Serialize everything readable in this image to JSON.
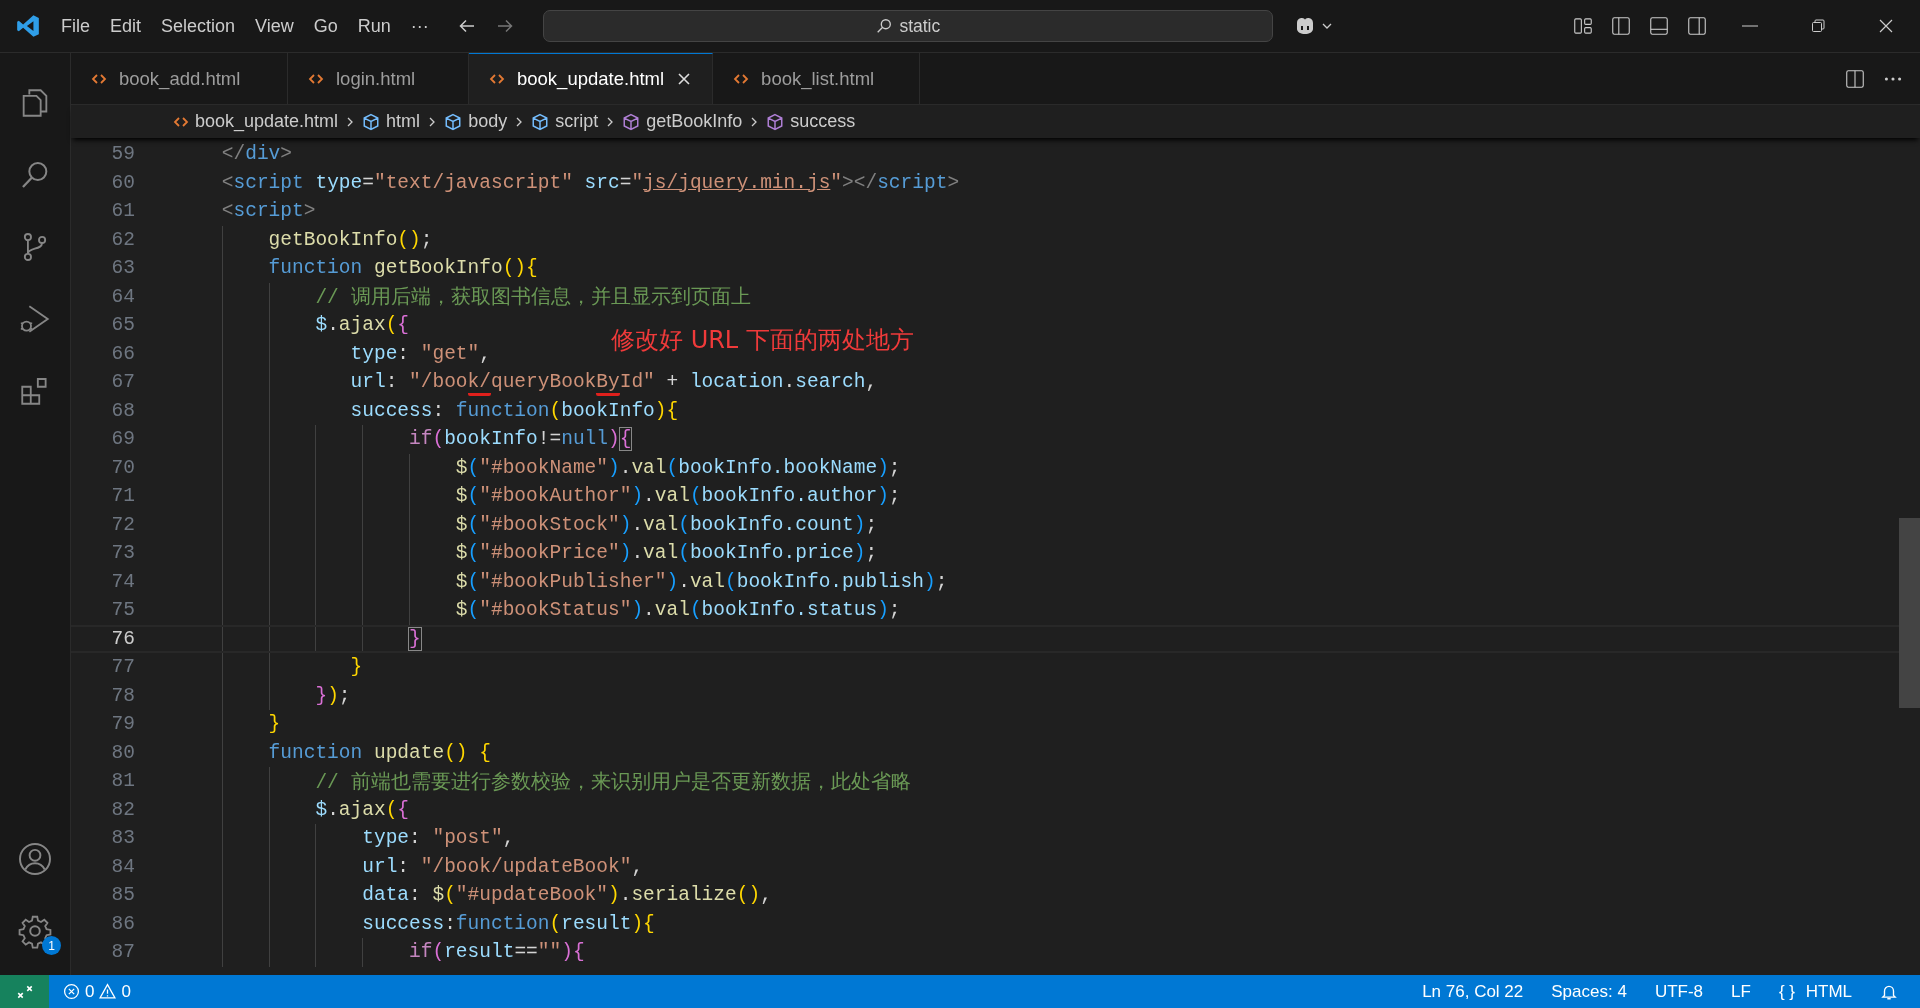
{
  "title_bar": {
    "menu": [
      "File",
      "Edit",
      "Selection",
      "View",
      "Go",
      "Run",
      "···"
    ],
    "search": {
      "value": "static"
    }
  },
  "activity_bar": {
    "items": [
      {
        "kind": "explorer",
        "selected": false
      },
      {
        "kind": "search",
        "selected": false
      },
      {
        "kind": "source-control",
        "selected": false
      },
      {
        "kind": "run-debug",
        "selected": false
      },
      {
        "kind": "extensions",
        "selected": false
      }
    ],
    "settings_badge": "1"
  },
  "tabs": [
    {
      "label": "book_add.html",
      "selected": false
    },
    {
      "label": "login.html",
      "selected": false
    },
    {
      "label": "book_update.html",
      "selected": true
    },
    {
      "label": "book_list.html",
      "selected": false
    }
  ],
  "breadcrumb": [
    {
      "kind": "file",
      "label": "book_update.html"
    },
    {
      "kind": "element",
      "label": "html"
    },
    {
      "kind": "element",
      "label": "body"
    },
    {
      "kind": "element",
      "label": "script"
    },
    {
      "kind": "method",
      "label": "getBookInfo"
    },
    {
      "kind": "method",
      "label": "success"
    }
  ],
  "annotation": "修改好 URL 下面的两处地方",
  "lines": [
    {
      "number": "59",
      "current": false,
      "tokens": [
        {
          "kind": "punc",
          "text": "    </"
        },
        {
          "kind": "tag",
          "text": "div"
        },
        {
          "kind": "punc",
          "text": ">"
        }
      ]
    },
    {
      "number": "60",
      "current": false,
      "tokens": [
        {
          "kind": "punc",
          "text": "    <"
        },
        {
          "kind": "tag",
          "text": "script "
        },
        {
          "kind": "attr",
          "text": "type"
        },
        {
          "kind": "txt",
          "text": "="
        },
        {
          "kind": "str",
          "text": "\"text/javascript\" "
        },
        {
          "kind": "attr",
          "text": "src"
        },
        {
          "kind": "txt",
          "text": "="
        },
        {
          "kind": "str",
          "text": "\""
        },
        {
          "kind": "link",
          "text": "js/jquery.min.js"
        },
        {
          "kind": "str",
          "text": "\""
        },
        {
          "kind": "punc",
          "text": "></"
        },
        {
          "kind": "tag",
          "text": "script"
        },
        {
          "kind": "punc",
          "text": ">"
        }
      ]
    },
    {
      "number": "61",
      "current": false,
      "tokens": [
        {
          "kind": "punc",
          "text": "    <"
        },
        {
          "kind": "tag",
          "text": "script"
        },
        {
          "kind": "punc",
          "text": ">"
        }
      ]
    },
    {
      "number": "62",
      "current": false,
      "tokens": [
        {
          "kind": "fn",
          "text": "        getBookInfo"
        },
        {
          "kind": "b1",
          "text": "()"
        },
        {
          "kind": "txt",
          "text": ";"
        }
      ]
    },
    {
      "number": "63",
      "current": false,
      "tokens": [
        {
          "kind": "kw",
          "text": "        function "
        },
        {
          "kind": "fn",
          "text": "getBookInfo"
        },
        {
          "kind": "b1",
          "text": "(){"
        }
      ]
    },
    {
      "number": "64",
      "current": false,
      "tokens": [
        {
          "kind": "cmt",
          "text": "            // 调用后端，获取图书信息，并且显示到页面上"
        }
      ]
    },
    {
      "number": "65",
      "current": false,
      "tokens": [
        {
          "kind": "var",
          "text": "            $"
        },
        {
          "kind": "txt",
          "text": "."
        },
        {
          "kind": "fn",
          "text": "ajax"
        },
        {
          "kind": "b1",
          "text": "("
        },
        {
          "kind": "b2",
          "text": "{"
        }
      ]
    },
    {
      "number": "66",
      "current": false,
      "tokens": [
        {
          "kind": "var",
          "text": "               type"
        },
        {
          "kind": "txt",
          "text": ": "
        },
        {
          "kind": "str",
          "text": "\"get\""
        },
        {
          "kind": "txt",
          "text": ","
        }
      ]
    },
    {
      "number": "67",
      "current": false,
      "tokens": [
        {
          "kind": "var",
          "text": "               url"
        },
        {
          "kind": "txt",
          "text": ": "
        },
        {
          "kind": "str",
          "text": "\"/boo"
        },
        {
          "kind": "str",
          "text": "k/",
          "underline": true
        },
        {
          "kind": "str",
          "text": "queryBook"
        },
        {
          "kind": "str",
          "text": "By",
          "underline": true
        },
        {
          "kind": "str",
          "text": "Id\""
        },
        {
          "kind": "txt",
          "text": " + "
        },
        {
          "kind": "var",
          "text": "location"
        },
        {
          "kind": "txt",
          "text": "."
        },
        {
          "kind": "var",
          "text": "search"
        },
        {
          "kind": "txt",
          "text": ","
        }
      ]
    },
    {
      "number": "68",
      "current": false,
      "tokens": [
        {
          "kind": "var",
          "text": "               success"
        },
        {
          "kind": "txt",
          "text": ": "
        },
        {
          "kind": "kw",
          "text": "function"
        },
        {
          "kind": "b1",
          "text": "("
        },
        {
          "kind": "var",
          "text": "bookInfo"
        },
        {
          "kind": "b1",
          "text": "){"
        }
      ]
    },
    {
      "number": "69",
      "current": false,
      "tokens": [
        {
          "kind": "ctl",
          "text": "                    if"
        },
        {
          "kind": "b2",
          "text": "("
        },
        {
          "kind": "var",
          "text": "bookInfo"
        },
        {
          "kind": "txt",
          "text": "!="
        },
        {
          "kind": "kw",
          "text": "null"
        },
        {
          "kind": "b2",
          "text": ")"
        },
        {
          "kind": "b2",
          "text": "{",
          "boxed": true
        }
      ]
    },
    {
      "number": "70",
      "current": false,
      "tokens": [
        {
          "kind": "fn",
          "text": "                        $"
        },
        {
          "kind": "b3",
          "text": "("
        },
        {
          "kind": "str",
          "text": "\"#bookName\""
        },
        {
          "kind": "b3",
          "text": ")"
        },
        {
          "kind": "txt",
          "text": "."
        },
        {
          "kind": "fn",
          "text": "val"
        },
        {
          "kind": "b3",
          "text": "("
        },
        {
          "kind": "var",
          "text": "bookInfo.bookName"
        },
        {
          "kind": "b3",
          "text": ")"
        },
        {
          "kind": "txt",
          "text": ";"
        }
      ]
    },
    {
      "number": "71",
      "current": false,
      "tokens": [
        {
          "kind": "fn",
          "text": "                        $"
        },
        {
          "kind": "b3",
          "text": "("
        },
        {
          "kind": "str",
          "text": "\"#bookAuthor\""
        },
        {
          "kind": "b3",
          "text": ")"
        },
        {
          "kind": "txt",
          "text": "."
        },
        {
          "kind": "fn",
          "text": "val"
        },
        {
          "kind": "b3",
          "text": "("
        },
        {
          "kind": "var",
          "text": "bookInfo.author"
        },
        {
          "kind": "b3",
          "text": ")"
        },
        {
          "kind": "txt",
          "text": ";"
        }
      ]
    },
    {
      "number": "72",
      "current": false,
      "tokens": [
        {
          "kind": "fn",
          "text": "                        $"
        },
        {
          "kind": "b3",
          "text": "("
        },
        {
          "kind": "str",
          "text": "\"#bookStock\""
        },
        {
          "kind": "b3",
          "text": ")"
        },
        {
          "kind": "txt",
          "text": "."
        },
        {
          "kind": "fn",
          "text": "val"
        },
        {
          "kind": "b3",
          "text": "("
        },
        {
          "kind": "var",
          "text": "bookInfo.count"
        },
        {
          "kind": "b3",
          "text": ")"
        },
        {
          "kind": "txt",
          "text": ";"
        }
      ]
    },
    {
      "number": "73",
      "current": false,
      "tokens": [
        {
          "kind": "fn",
          "text": "                        $"
        },
        {
          "kind": "b3",
          "text": "("
        },
        {
          "kind": "str",
          "text": "\"#bookPrice\""
        },
        {
          "kind": "b3",
          "text": ")"
        },
        {
          "kind": "txt",
          "text": "."
        },
        {
          "kind": "fn",
          "text": "val"
        },
        {
          "kind": "b3",
          "text": "("
        },
        {
          "kind": "var",
          "text": "bookInfo.price"
        },
        {
          "kind": "b3",
          "text": ")"
        },
        {
          "kind": "txt",
          "text": ";"
        }
      ]
    },
    {
      "number": "74",
      "current": false,
      "tokens": [
        {
          "kind": "fn",
          "text": "                        $"
        },
        {
          "kind": "b3",
          "text": "("
        },
        {
          "kind": "str",
          "text": "\"#bookPublisher\""
        },
        {
          "kind": "b3",
          "text": ")"
        },
        {
          "kind": "txt",
          "text": "."
        },
        {
          "kind": "fn",
          "text": "val"
        },
        {
          "kind": "b3",
          "text": "("
        },
        {
          "kind": "var",
          "text": "bookInfo.publish"
        },
        {
          "kind": "b3",
          "text": ")"
        },
        {
          "kind": "txt",
          "text": ";"
        }
      ]
    },
    {
      "number": "75",
      "current": false,
      "tokens": [
        {
          "kind": "fn",
          "text": "                        $"
        },
        {
          "kind": "b3",
          "text": "("
        },
        {
          "kind": "str",
          "text": "\"#bookStatus\""
        },
        {
          "kind": "b3",
          "text": ")"
        },
        {
          "kind": "txt",
          "text": "."
        },
        {
          "kind": "fn",
          "text": "val"
        },
        {
          "kind": "b3",
          "text": "("
        },
        {
          "kind": "var",
          "text": "bookInfo.status"
        },
        {
          "kind": "b3",
          "text": ")"
        },
        {
          "kind": "txt",
          "text": ";"
        }
      ]
    },
    {
      "number": "76",
      "current": true,
      "tokens": [
        {
          "kind": "b2",
          "text": "                    }",
          "boxed": true
        }
      ]
    },
    {
      "number": "77",
      "current": false,
      "tokens": [
        {
          "kind": "b1",
          "text": "               }"
        }
      ]
    },
    {
      "number": "78",
      "current": false,
      "tokens": [
        {
          "kind": "b2",
          "text": "            }"
        },
        {
          "kind": "b1",
          "text": ")"
        },
        {
          "kind": "txt",
          "text": ";"
        }
      ]
    },
    {
      "number": "79",
      "current": false,
      "tokens": [
        {
          "kind": "b1",
          "text": "        }"
        }
      ]
    },
    {
      "number": "80",
      "current": false,
      "tokens": [
        {
          "kind": "kw",
          "text": "        function "
        },
        {
          "kind": "fn",
          "text": "update"
        },
        {
          "kind": "b1",
          "text": "() {"
        }
      ]
    },
    {
      "number": "81",
      "current": false,
      "tokens": [
        {
          "kind": "cmt",
          "text": "            // 前端也需要进行参数校验，来识别用户是否更新数据，此处省略"
        }
      ]
    },
    {
      "number": "82",
      "current": false,
      "tokens": [
        {
          "kind": "var",
          "text": "            $"
        },
        {
          "kind": "txt",
          "text": "."
        },
        {
          "kind": "fn",
          "text": "ajax"
        },
        {
          "kind": "b1",
          "text": "("
        },
        {
          "kind": "b2",
          "text": "{"
        }
      ]
    },
    {
      "number": "83",
      "current": false,
      "tokens": [
        {
          "kind": "var",
          "text": "                type"
        },
        {
          "kind": "txt",
          "text": ": "
        },
        {
          "kind": "str",
          "text": "\"post\""
        },
        {
          "kind": "txt",
          "text": ","
        }
      ]
    },
    {
      "number": "84",
      "current": false,
      "tokens": [
        {
          "kind": "var",
          "text": "                url"
        },
        {
          "kind": "txt",
          "text": ": "
        },
        {
          "kind": "str",
          "text": "\"/book/updateBook\""
        },
        {
          "kind": "txt",
          "text": ","
        }
      ]
    },
    {
      "number": "85",
      "current": false,
      "tokens": [
        {
          "kind": "var",
          "text": "                data"
        },
        {
          "kind": "txt",
          "text": ": "
        },
        {
          "kind": "fn",
          "text": "$"
        },
        {
          "kind": "b1",
          "text": "("
        },
        {
          "kind": "str",
          "text": "\"#updateBook\""
        },
        {
          "kind": "b1",
          "text": ")"
        },
        {
          "kind": "txt",
          "text": "."
        },
        {
          "kind": "fn",
          "text": "serialize"
        },
        {
          "kind": "b1",
          "text": "()"
        },
        {
          "kind": "txt",
          "text": ","
        }
      ]
    },
    {
      "number": "86",
      "current": false,
      "tokens": [
        {
          "kind": "var",
          "text": "                success"
        },
        {
          "kind": "txt",
          "text": ":"
        },
        {
          "kind": "kw",
          "text": "function"
        },
        {
          "kind": "b1",
          "text": "("
        },
        {
          "kind": "var",
          "text": "result"
        },
        {
          "kind": "b1",
          "text": "){"
        }
      ]
    },
    {
      "number": "87",
      "current": false,
      "tokens": [
        {
          "kind": "ctl",
          "text": "                    if"
        },
        {
          "kind": "b2",
          "text": "("
        },
        {
          "kind": "var",
          "text": "result"
        },
        {
          "kind": "txt",
          "text": "=="
        },
        {
          "kind": "str",
          "text": "\"\""
        },
        {
          "kind": "b2",
          "text": "){"
        }
      ]
    }
  ],
  "status_bar": {
    "errors": "0",
    "warnings": "0",
    "right": [
      {
        "kind": "text",
        "label": "Ln 76, Col 22"
      },
      {
        "kind": "text",
        "label": "Spaces: 4"
      },
      {
        "kind": "text",
        "label": "UTF-8"
      },
      {
        "kind": "text",
        "label": "LF"
      },
      {
        "kind": "language",
        "icon_text": "{ }",
        "label": "HTML"
      }
    ]
  }
}
